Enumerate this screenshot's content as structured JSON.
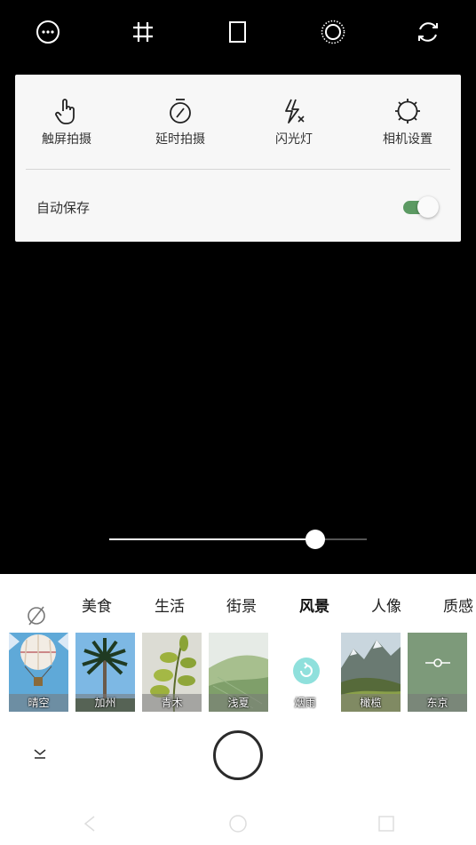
{
  "toolbar": {
    "icons": [
      "more-icon",
      "grid-icon",
      "aspect-ratio-icon",
      "effect-ring-icon",
      "switch-camera-icon"
    ]
  },
  "settings_panel": {
    "items": [
      {
        "label": "触屏拍摄",
        "icon": "touch-shoot-icon"
      },
      {
        "label": "延时拍摄",
        "icon": "timer-icon"
      },
      {
        "label": "闪光灯",
        "icon": "flash-off-icon"
      },
      {
        "label": "相机设置",
        "icon": "camera-settings-icon"
      }
    ],
    "autosave_label": "自动保存",
    "autosave_on": true
  },
  "exposure_slider": {
    "value": 0.8
  },
  "categories": {
    "none_icon": "no-filter-icon",
    "items": [
      "美食",
      "生活",
      "街景",
      "风景",
      "人像",
      "质感"
    ],
    "active": "风景"
  },
  "filters": [
    {
      "name": "晴空"
    },
    {
      "name": "加州"
    },
    {
      "name": "青木"
    },
    {
      "name": "浅夏"
    },
    {
      "name": "烟雨",
      "selected": true
    },
    {
      "name": "橄榄"
    },
    {
      "name": "东京"
    }
  ],
  "controls": {
    "collapse_icon": "chevron-down-icon",
    "shutter": "shutter-button"
  },
  "navbar": {
    "icons": [
      "back-icon",
      "home-icon",
      "recents-icon"
    ]
  },
  "colors": {
    "toggle_on": "#5c9a63",
    "selected_filter": "#8fe0dc",
    "tokyo_bg": "#7d9a7a"
  }
}
